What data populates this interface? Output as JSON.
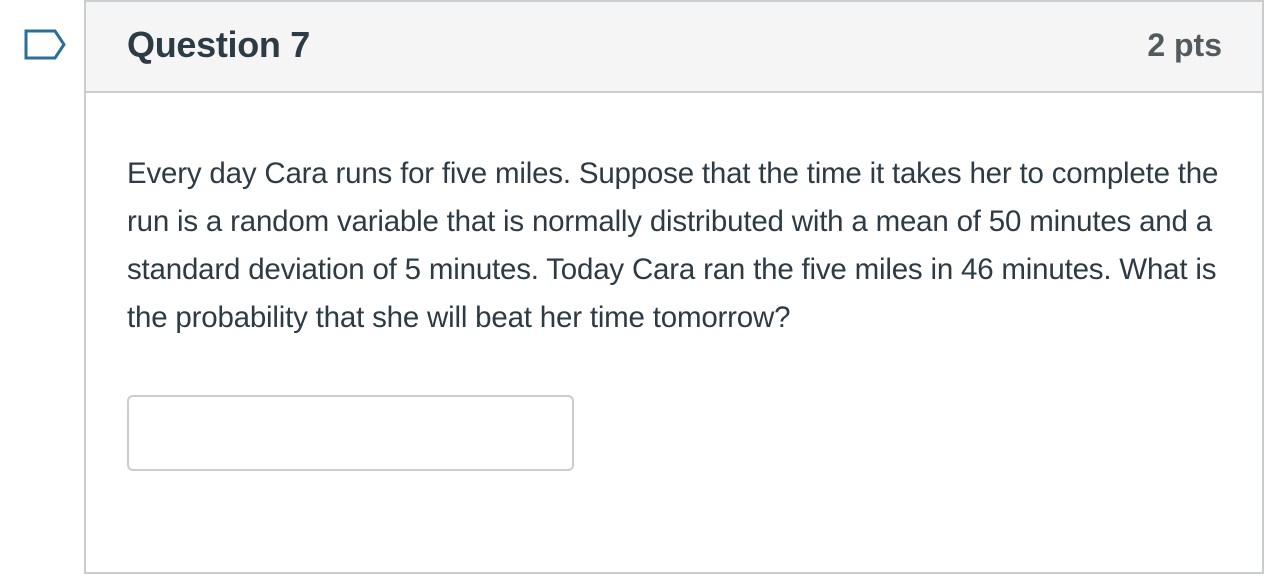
{
  "question": {
    "title": "Question 7",
    "points": "2 pts",
    "text": "Every day Cara runs for five miles. Suppose that the time it takes her to complete the run is a random variable that is normally distributed with a mean of 50 minutes and a standard deviation of 5 minutes. Today Cara ran the five miles in 46 minutes. What is the probability that she will beat her time tomorrow?",
    "answer_value": "",
    "flag_icon": "flag-icon"
  },
  "colors": {
    "border": "#c7cdd1",
    "header_background": "#f5f5f5",
    "text": "#2d3b45",
    "points_text": "#505a5f",
    "flag_outline": "#2b6f97"
  }
}
